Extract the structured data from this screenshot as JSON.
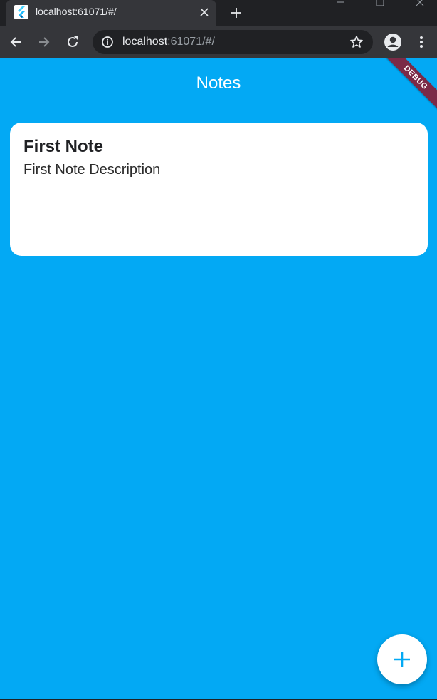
{
  "browser": {
    "tab": {
      "title": "localhost:61071/#/",
      "favicon": "flutter-icon"
    },
    "address": {
      "host": "localhost",
      "rest": ":61071/#/"
    },
    "icons": {
      "back": "arrow-left-icon",
      "forward": "arrow-right-icon",
      "reload": "reload-icon",
      "info": "info-icon",
      "star": "star-icon",
      "profile": "account-icon",
      "menu": "more-vert-icon",
      "new_tab": "plus-icon",
      "close_tab": "close-icon"
    }
  },
  "app": {
    "title": "Notes",
    "debug_label": "DEBUG",
    "colors": {
      "background": "#03a9f4",
      "card": "#ffffff",
      "fab_icon": "#03a9f4",
      "debug_banner": "#7b2a47"
    },
    "notes": [
      {
        "title": "First Note",
        "description": "First Note Description"
      }
    ],
    "fab": {
      "icon": "add-icon"
    }
  }
}
